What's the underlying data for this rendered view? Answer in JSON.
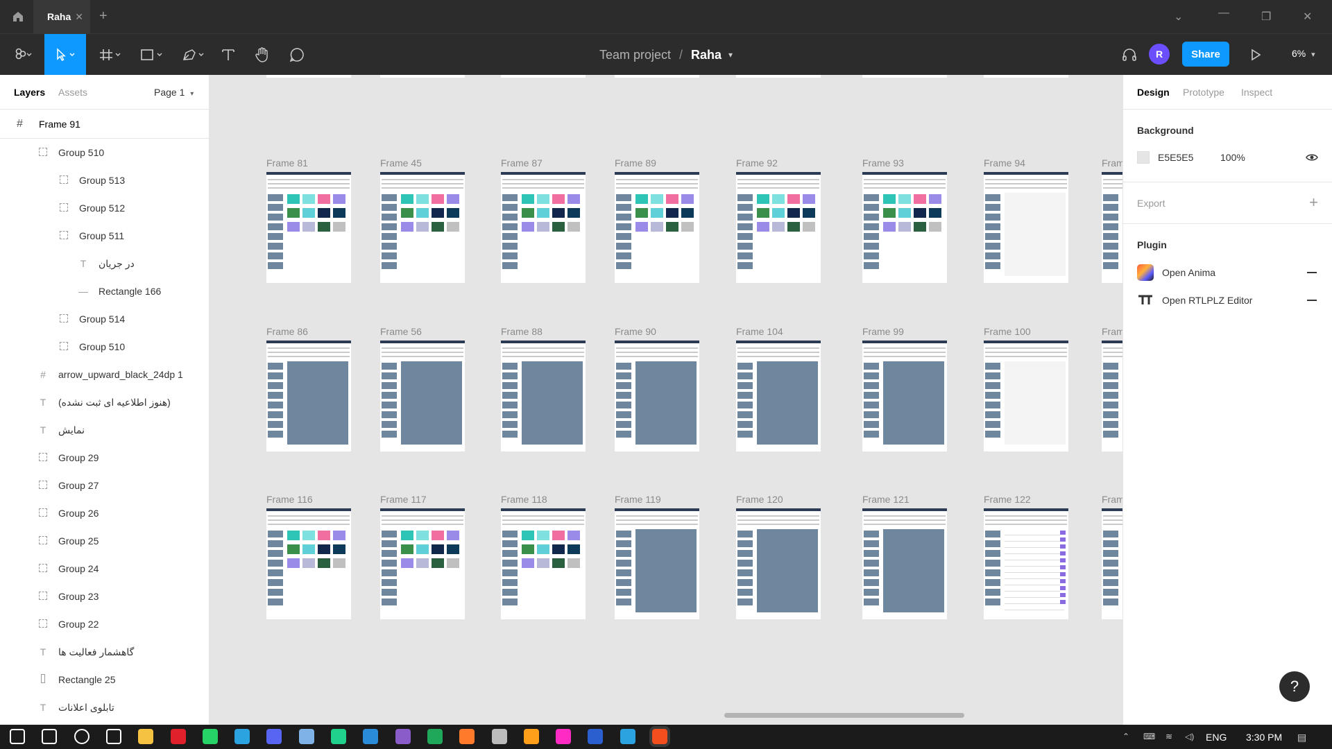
{
  "titlebar": {
    "tab_label": "Raha",
    "close_glyph": "✕",
    "new_tab_glyph": "+"
  },
  "toolbar": {
    "team": "Team project",
    "separator": "/",
    "file": "Raha",
    "avatar_letter": "R",
    "share_label": "Share",
    "zoom": "6%"
  },
  "left_panel": {
    "tab_layers": "Layers",
    "tab_assets": "Assets",
    "page": "Page 1",
    "root_frame": "Frame 91",
    "layers": [
      {
        "label": "Group 510",
        "type": "group",
        "depth": 1
      },
      {
        "label": "Group 513",
        "type": "group",
        "depth": 2
      },
      {
        "label": "Group 512",
        "type": "group",
        "depth": 2
      },
      {
        "label": "Group 511",
        "type": "group",
        "depth": 2
      },
      {
        "label": "در جریان",
        "type": "text",
        "depth": 3
      },
      {
        "label": "Rectangle 166",
        "type": "line",
        "depth": 3
      },
      {
        "label": "Group 514",
        "type": "group",
        "depth": 2
      },
      {
        "label": "Group 510",
        "type": "group",
        "depth": 2
      },
      {
        "label": "arrow_upward_black_24dp 1",
        "type": "frame",
        "depth": 1
      },
      {
        "label": "(هنوز اطلاعیه ای ثبت نشده)",
        "type": "text",
        "depth": 1
      },
      {
        "label": "نمایش",
        "type": "text",
        "depth": 1
      },
      {
        "label": "Group 29",
        "type": "group",
        "depth": 1
      },
      {
        "label": "Group 27",
        "type": "group",
        "depth": 1
      },
      {
        "label": "Group 26",
        "type": "group",
        "depth": 1
      },
      {
        "label": "Group 25",
        "type": "group",
        "depth": 1
      },
      {
        "label": "Group 24",
        "type": "group",
        "depth": 1
      },
      {
        "label": "Group 23",
        "type": "group",
        "depth": 1
      },
      {
        "label": "Group 22",
        "type": "group",
        "depth": 1
      },
      {
        "label": "گاهشمار فعالیت ها",
        "type": "text",
        "depth": 1
      },
      {
        "label": "Rectangle 25",
        "type": "rect",
        "depth": 1
      },
      {
        "label": "تابلوی اعلانات",
        "type": "text",
        "depth": 1
      }
    ]
  },
  "canvas": {
    "background": "#E5E5E5",
    "rows": [
      [
        {
          "label": "Frame 81",
          "kind": "tiles"
        },
        {
          "label": "Frame 45",
          "kind": "tiles"
        },
        {
          "label": "Frame 87",
          "kind": "tiles"
        },
        {
          "label": "Frame 89",
          "kind": "tiles"
        },
        {
          "label": "Frame 92",
          "kind": "tiles"
        },
        {
          "label": "Frame 93",
          "kind": "tiles"
        },
        {
          "label": "Frame 94",
          "kind": "blank"
        },
        {
          "label": "Frame",
          "kind": "tiles"
        }
      ],
      [
        {
          "label": "Frame 86",
          "kind": "big"
        },
        {
          "label": "Frame 56",
          "kind": "big"
        },
        {
          "label": "Frame 88",
          "kind": "big"
        },
        {
          "label": "Frame 90",
          "kind": "big"
        },
        {
          "label": "Frame 104",
          "kind": "big"
        },
        {
          "label": "Frame 99",
          "kind": "big"
        },
        {
          "label": "Frame 100",
          "kind": "blank"
        },
        {
          "label": "Frame",
          "kind": "blank"
        }
      ],
      [
        {
          "label": "Frame 116",
          "kind": "tiles"
        },
        {
          "label": "Frame 117",
          "kind": "tiles"
        },
        {
          "label": "Frame 118",
          "kind": "tiles"
        },
        {
          "label": "Frame 119",
          "kind": "big"
        },
        {
          "label": "Frame 120",
          "kind": "big"
        },
        {
          "label": "Frame 121",
          "kind": "big"
        },
        {
          "label": "Frame 122",
          "kind": "list"
        },
        {
          "label": "Frame",
          "kind": "tiles"
        }
      ]
    ],
    "tile_colors": [
      "#2ec4b6",
      "#7fe0e0",
      "#f06fa0",
      "#9b8be8",
      "#3a8f4a",
      "#5fd0d8",
      "#11274b",
      "#0e3a5a",
      "#9b8be8",
      "#b8b8d8",
      "#2a5f3f",
      "#c0c0c0"
    ]
  },
  "right_panel": {
    "tab_design": "Design",
    "tab_prototype": "Prototype",
    "tab_inspect": "Inspect",
    "background_title": "Background",
    "bg_hex": "E5E5E5",
    "bg_opacity": "100%",
    "export_title": "Export",
    "plugin_title": "Plugin",
    "plugins": [
      {
        "label": "Open Anima"
      },
      {
        "label": "Open RTLPLZ Editor"
      }
    ],
    "help_glyph": "?"
  },
  "taskbar": {
    "language": "ENG",
    "time": "3:30 PM",
    "apps": [
      "windows-start",
      "search",
      "cortana",
      "task-view",
      "file-explorer",
      "opera",
      "whatsapp",
      "telegram",
      "discord",
      "app-cube",
      "pycharm",
      "vscode",
      "app-m",
      "excel-like",
      "app-orange",
      "wordpress",
      "app-box",
      "adobe-xd",
      "word",
      "telegram-2",
      "figma"
    ]
  }
}
